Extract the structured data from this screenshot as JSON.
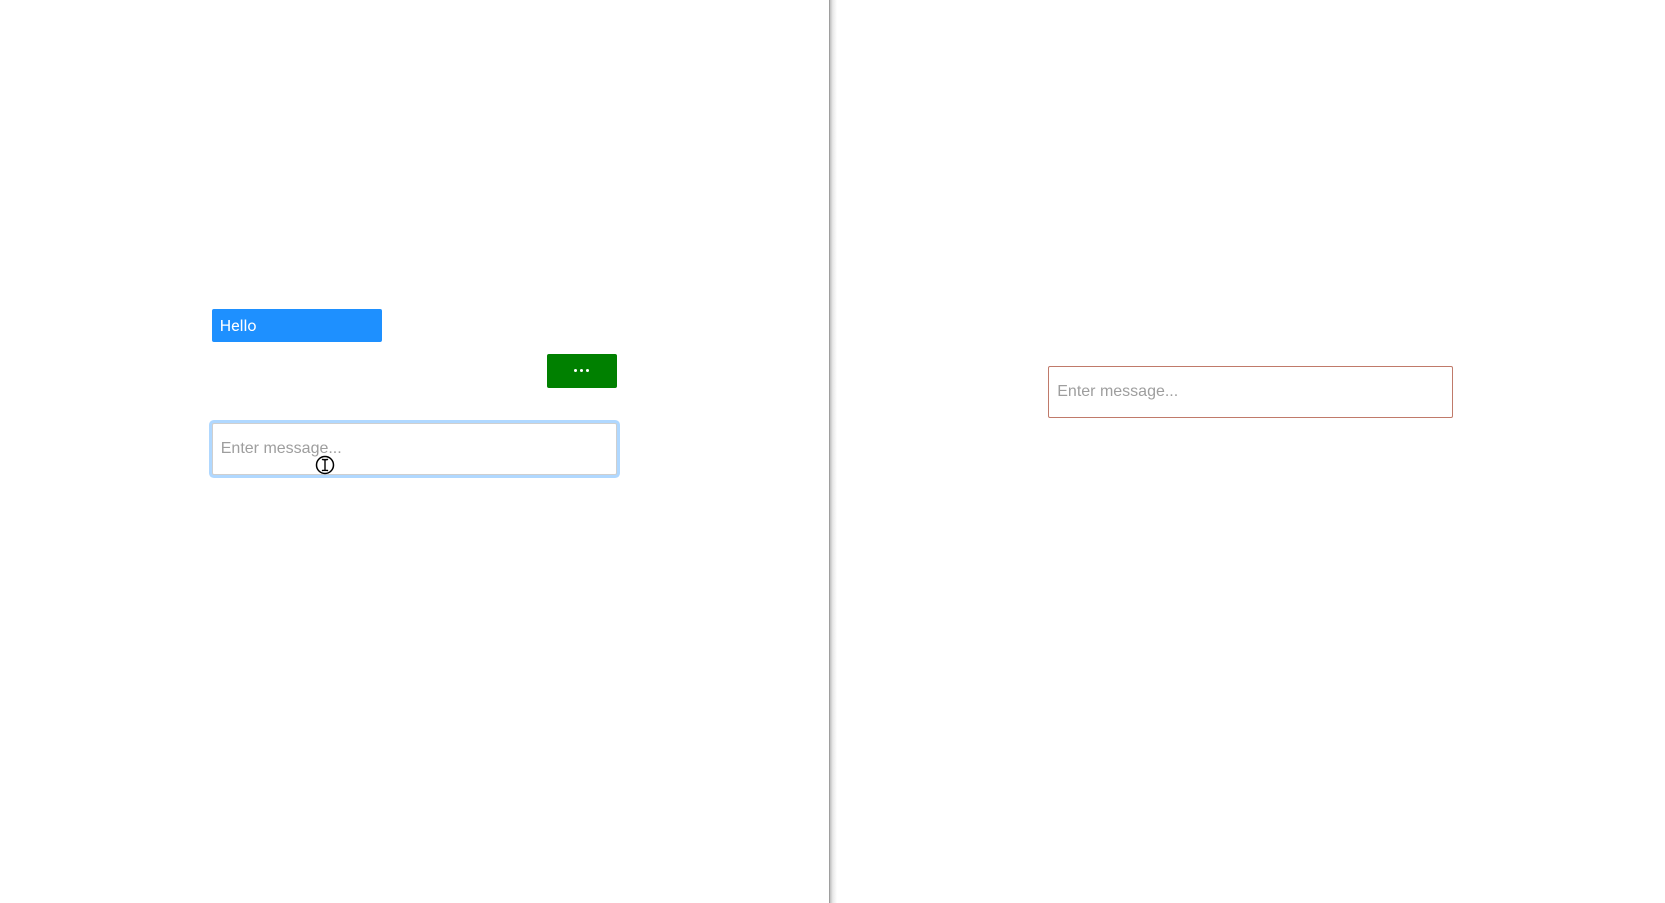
{
  "left": {
    "messages": [
      {
        "text": "Hello",
        "type": "outgoing"
      }
    ],
    "typing_indicator": "...",
    "input_placeholder": "Enter message...",
    "input_value": ""
  },
  "right": {
    "input_placeholder": "Enter message...",
    "input_value": ""
  },
  "colors": {
    "outgoing_bubble": "#1e90ff",
    "typing_bubble": "#008000",
    "right_input_border": "#c07a6a"
  }
}
